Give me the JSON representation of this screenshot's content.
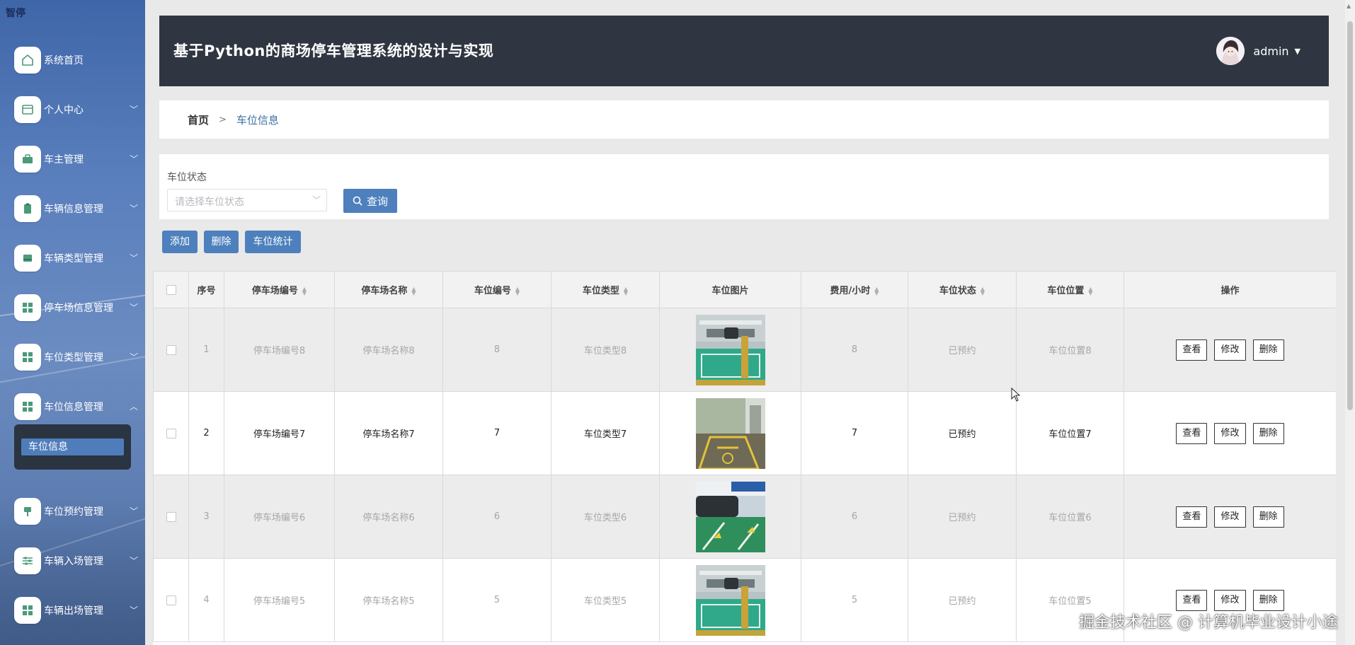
{
  "app": {
    "brand": "智停",
    "title": "基于Python的商场停车管理系统的设计与实现",
    "user": "admin"
  },
  "sidebar": {
    "items": [
      {
        "label": "系统首页",
        "icon": "home-icon",
        "expandable": false
      },
      {
        "label": "个人中心",
        "icon": "id-card-icon",
        "expandable": true
      },
      {
        "label": "车主管理",
        "icon": "briefcase-icon",
        "expandable": true
      },
      {
        "label": "车辆信息管理",
        "icon": "clipboard-icon",
        "expandable": true
      },
      {
        "label": "车辆类型管理",
        "icon": "folder-icon",
        "expandable": true
      },
      {
        "label": "停车场信息管理",
        "icon": "grid-icon",
        "expandable": true
      },
      {
        "label": "车位类型管理",
        "icon": "grid-icon",
        "expandable": true
      },
      {
        "label": "车位信息管理",
        "icon": "grid-icon",
        "expandable": true,
        "expanded": true
      },
      {
        "label": "车位预约管理",
        "icon": "pin-icon",
        "expandable": true
      },
      {
        "label": "车辆入场管理",
        "icon": "sliders-icon",
        "expandable": true
      },
      {
        "label": "车辆出场管理",
        "icon": "grid-icon",
        "expandable": true
      }
    ],
    "submenu": {
      "label": "车位信息",
      "active": true
    }
  },
  "breadcrumb": {
    "home": "首页",
    "separator": ">",
    "current": "车位信息"
  },
  "search": {
    "field_label": "车位状态",
    "placeholder": "请选择车位状态",
    "query_button": "查询"
  },
  "actions": {
    "add": "添加",
    "delete": "删除",
    "stats": "车位统计"
  },
  "table": {
    "columns": [
      "序号",
      "停车场编号",
      "停车场名称",
      "车位编号",
      "车位类型",
      "车位图片",
      "费用/小时",
      "车位状态",
      "车位位置",
      "操作"
    ],
    "row_actions": {
      "view": "查看",
      "edit": "修改",
      "delete": "删除"
    },
    "rows": [
      {
        "index": "1",
        "lot_no": "停车场编号8",
        "lot_name": "停车场名称8",
        "space_no": "8",
        "space_type": "车位类型8",
        "fee": "8",
        "status": "已预约",
        "position": "车位位置8"
      },
      {
        "index": "2",
        "lot_no": "停车场编号7",
        "lot_name": "停车场名称7",
        "space_no": "7",
        "space_type": "车位类型7",
        "fee": "7",
        "status": "已预约",
        "position": "车位位置7"
      },
      {
        "index": "3",
        "lot_no": "停车场编号6",
        "lot_name": "停车场名称6",
        "space_no": "6",
        "space_type": "车位类型6",
        "fee": "6",
        "status": "已预约",
        "position": "车位位置6"
      },
      {
        "index": "4",
        "lot_no": "停车场编号5",
        "lot_name": "停车场名称5",
        "space_no": "5",
        "space_type": "车位类型5",
        "fee": "5",
        "status": "已预约",
        "position": "车位位置5"
      }
    ]
  },
  "watermark": "掘金技术社区 @ 计算机毕业设计小途"
}
